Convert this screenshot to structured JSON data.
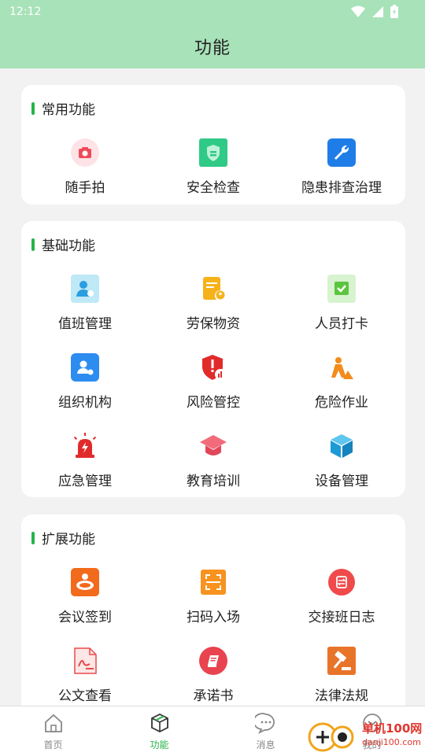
{
  "status_bar": {
    "time": "12:12"
  },
  "header": {
    "title": "功能"
  },
  "sections": {
    "common": {
      "title": "常用功能",
      "items": [
        {
          "label": "随手拍",
          "icon": "camera-icon"
        },
        {
          "label": "安全检查",
          "icon": "shield-icon"
        },
        {
          "label": "隐患排查治理",
          "icon": "wrench-icon"
        }
      ]
    },
    "basic": {
      "title": "基础功能",
      "items": [
        {
          "label": "值班管理",
          "icon": "duty-user-icon"
        },
        {
          "label": "劳保物资",
          "icon": "document-user-icon"
        },
        {
          "label": "人员打卡",
          "icon": "calendar-check-icon"
        },
        {
          "label": "组织机构",
          "icon": "organization-icon"
        },
        {
          "label": "风险管控",
          "icon": "risk-shield-icon"
        },
        {
          "label": "危险作业",
          "icon": "construction-worker-icon"
        },
        {
          "label": "应急管理",
          "icon": "alarm-light-icon"
        },
        {
          "label": "教育培训",
          "icon": "graduation-cap-icon"
        },
        {
          "label": "设备管理",
          "icon": "cube-icon"
        }
      ]
    },
    "extended": {
      "title": "扩展功能",
      "items": [
        {
          "label": "会议签到",
          "icon": "meeting-icon"
        },
        {
          "label": "扫码入场",
          "icon": "scan-icon"
        },
        {
          "label": "交接班日志",
          "icon": "handover-icon"
        },
        {
          "label": "公文查看",
          "icon": "pdf-document-icon"
        },
        {
          "label": "承诺书",
          "icon": "book-icon"
        },
        {
          "label": "法律法规",
          "icon": "gavel-icon"
        }
      ]
    }
  },
  "tab_bar": {
    "tabs": [
      {
        "label": "首页",
        "icon": "home-icon"
      },
      {
        "label": "功能",
        "icon": "box-icon"
      },
      {
        "label": "消息",
        "icon": "chat-icon"
      },
      {
        "label": "我的",
        "icon": "user-icon"
      }
    ],
    "active": "功能"
  },
  "watermark": {
    "text": "单机100网",
    "url": "danji100.com"
  },
  "colors": {
    "accent": "#27b34b",
    "header_bg": "#a8e2b8",
    "page_bg": "#f2f2f2"
  }
}
